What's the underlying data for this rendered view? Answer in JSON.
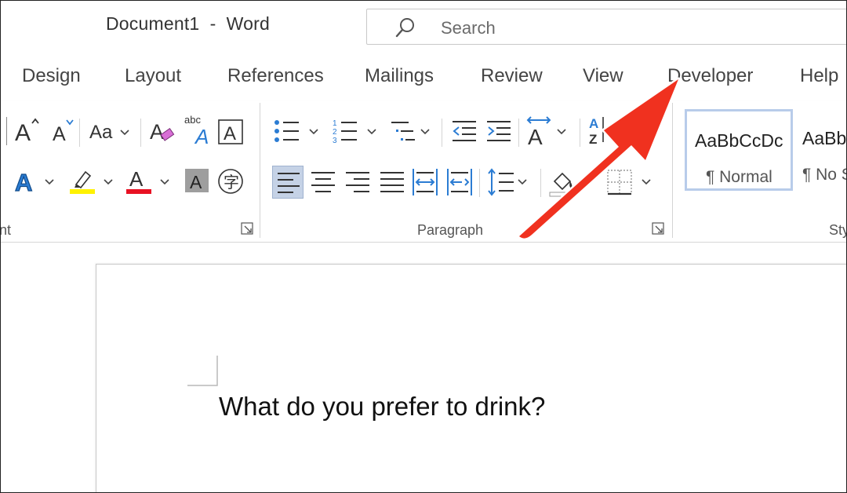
{
  "window": {
    "title": "Document1  -  Word"
  },
  "search": {
    "placeholder": "Search",
    "icon": "search-icon"
  },
  "tabs": [
    {
      "label": "Design"
    },
    {
      "label": "Layout"
    },
    {
      "label": "References"
    },
    {
      "label": "Mailings"
    },
    {
      "label": "Review"
    },
    {
      "label": "View"
    },
    {
      "label": "Developer"
    },
    {
      "label": "Help"
    }
  ],
  "ribbon": {
    "font_group": {
      "label_partial": "nt",
      "change_case_label": "Aa",
      "clear_formatting_icon": "clear-formatting-icon",
      "text_effects_icon": "text-effects-icon",
      "highlight_color": "#FFF200",
      "font_color": "#E81123"
    },
    "paragraph_group": {
      "label": "Paragraph",
      "sort_label": "AZ"
    },
    "styles_group": {
      "label_partial": "Sty",
      "styles": [
        {
          "sample": "AaBbCcDc",
          "name": "¶ Normal",
          "selected": true
        },
        {
          "sample": "AaBb",
          "name": "¶ No S",
          "selected": false
        }
      ]
    }
  },
  "document": {
    "text": "What do you prefer to drink?"
  },
  "annotation": {
    "arrow_color": "#F0311F",
    "points_to": "Developer"
  },
  "colors": {
    "accent_blue": "#2B7CD3",
    "selected_bg": "#C5D2E6",
    "style_border": "#B8CCEA"
  }
}
